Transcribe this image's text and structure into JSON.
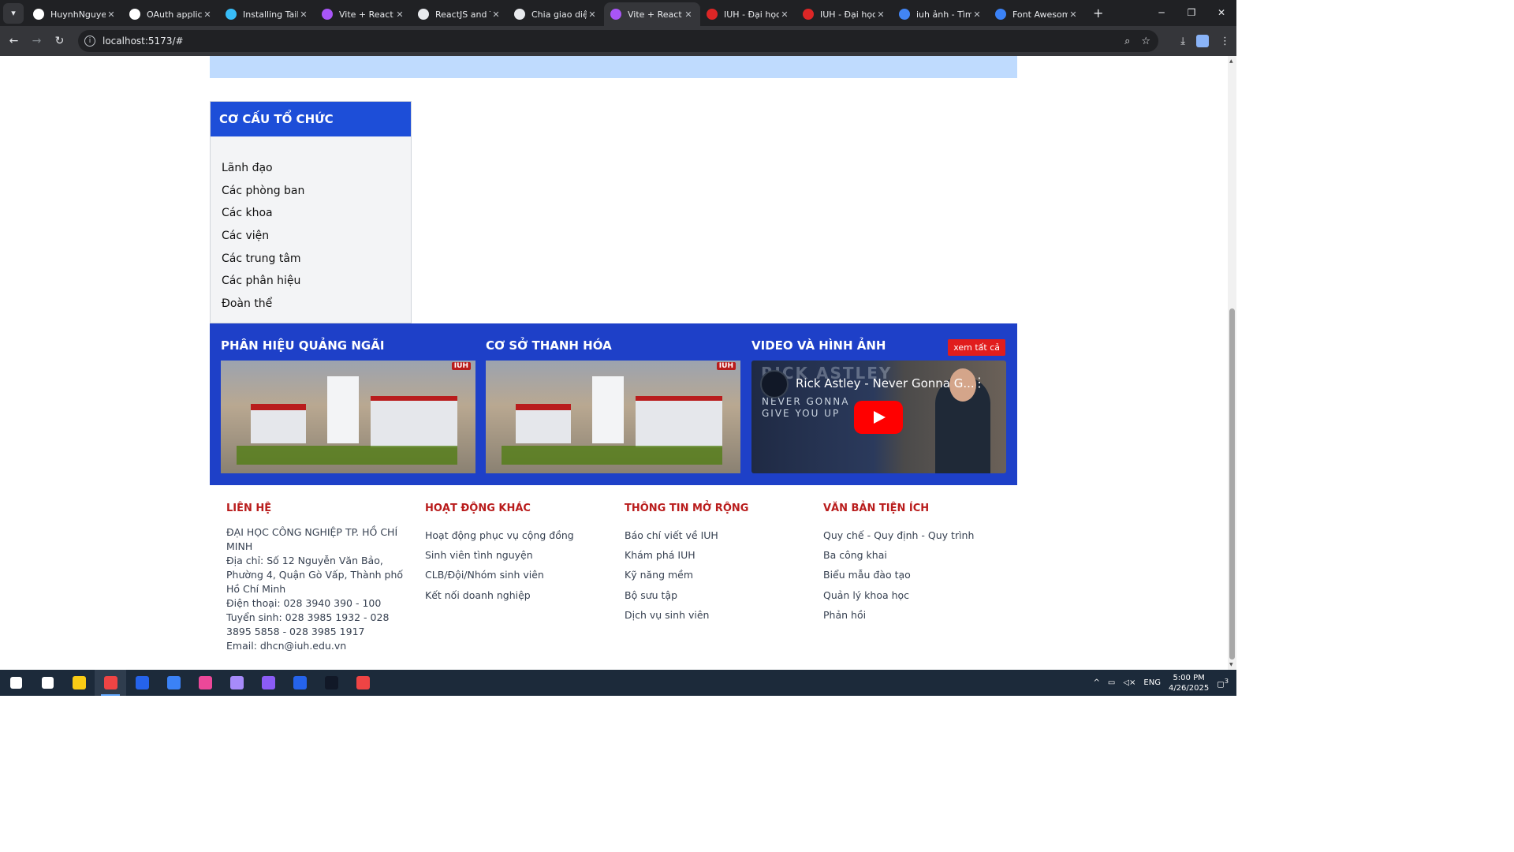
{
  "browser": {
    "tabs": [
      {
        "title": "HuynhNguyenKho",
        "favicon": "github-icon",
        "color": "#ffffff"
      },
      {
        "title": "OAuth applications",
        "favicon": "github-icon",
        "color": "#ffffff"
      },
      {
        "title": "Installing Tailwind",
        "favicon": "tailwind-icon",
        "color": "#38bdf8"
      },
      {
        "title": "Vite + React",
        "favicon": "vite-icon",
        "color": "#a855f7"
      },
      {
        "title": "ReactJS and Tailwind",
        "favicon": "link-icon",
        "color": "#e8eaed"
      },
      {
        "title": "Chia giao diện",
        "favicon": "openai-icon",
        "color": "#e8eaed"
      },
      {
        "title": "Vite + React",
        "favicon": "vite-icon",
        "color": "#a855f7"
      },
      {
        "title": "IUH - Đại học Công",
        "favicon": "iuh-icon",
        "color": "#dc2626"
      },
      {
        "title": "IUH - Đại học Công",
        "favicon": "iuh-icon",
        "color": "#dc2626"
      },
      {
        "title": "iuh ảnh - Tìm trên",
        "favicon": "google-icon",
        "color": "#4285f4"
      },
      {
        "title": "Font Awesome",
        "favicon": "fontawesome-icon",
        "color": "#3b82f6"
      }
    ],
    "active_tab": 6,
    "url": "localhost:5173/#",
    "close_glyph": "✕",
    "new_tab_glyph": "+"
  },
  "org": {
    "title": "CƠ CẤU TỔ CHỨC",
    "items": [
      "Lãnh đạo",
      "Các phòng ban",
      "Các khoa",
      "Các viện",
      "Các trung tâm",
      "Các phân hiệu",
      "Đoàn thể"
    ]
  },
  "band": {
    "quang_ngai": "PHÂN HIỆU QUẢNG NGÃI",
    "thanh_hoa": "CƠ SỞ THANH HÓA",
    "video_title": "VIDEO VÀ HÌNH ẢNH",
    "see_all": "xem tất cả",
    "image_logo": "IUH",
    "youtube": {
      "title": "Rick Astley - Never Gonna G...",
      "overlay_big": "RICK ASTLEY",
      "overlay_line1": "NEVER GONNA",
      "overlay_line2": "GIVE YOU UP"
    }
  },
  "footer": {
    "contact": {
      "heading": "LIÊN HỆ",
      "lines": [
        "ĐẠI HỌC CÔNG NGHIỆP TP. HỒ CHÍ MINH",
        "Địa chỉ: Số 12 Nguyễn Văn Bảo, Phường 4, Quận Gò Vấp, Thành phố Hồ Chí Minh",
        "Điện thoại: 028 3940 390 - 100",
        "Tuyển sinh: 028 3985 1932 - 028 3895 5858 - 028 3985 1917",
        "Email: dhcn@iuh.edu.vn"
      ]
    },
    "activities": {
      "heading": "HOẠT ĐỘNG KHÁC",
      "items": [
        "Hoạt động phục vụ cộng đồng",
        "Sinh viên tình nguyện",
        "CLB/Đội/Nhóm sinh viên",
        "Kết nối doanh nghiệp"
      ]
    },
    "info": {
      "heading": "THÔNG TIN MỞ RỘNG",
      "items": [
        "Báo chí viết về IUH",
        "Khám phá IUH",
        "Kỹ năng mềm",
        "Bộ sưu tập",
        "Dịch vụ sinh viên"
      ]
    },
    "docs": {
      "heading": "VĂN BẢN TIỆN ÍCH",
      "items": [
        "Quy chế - Quy định - Quy trình",
        "Ba công khai",
        "Biểu mẫu đào tạo",
        "Quản lý khoa học",
        "Phản hồi"
      ]
    }
  },
  "taskbar": {
    "apps": [
      {
        "name": "windows-start-icon",
        "color": "#ffffff"
      },
      {
        "name": "search-icon",
        "color": "#ffffff"
      },
      {
        "name": "file-explorer-icon",
        "color": "#facc15"
      },
      {
        "name": "chrome-icon",
        "color": "#ef4444"
      },
      {
        "name": "word-icon",
        "color": "#2563eb"
      },
      {
        "name": "vscode-icon",
        "color": "#3b82f6"
      },
      {
        "name": "app-pink-icon",
        "color": "#ec4899"
      },
      {
        "name": "app-striped-icon",
        "color": "#a78bfa"
      },
      {
        "name": "visual-studio-icon",
        "color": "#8b5cf6"
      },
      {
        "name": "powershell-icon",
        "color": "#2563eb"
      },
      {
        "name": "terminal-icon",
        "color": "#111827"
      },
      {
        "name": "app-red-icon",
        "color": "#ef4444"
      }
    ],
    "active_app": 3,
    "lang": "ENG",
    "time": "5:00 PM",
    "date": "4/26/2025",
    "notifications": "3"
  }
}
